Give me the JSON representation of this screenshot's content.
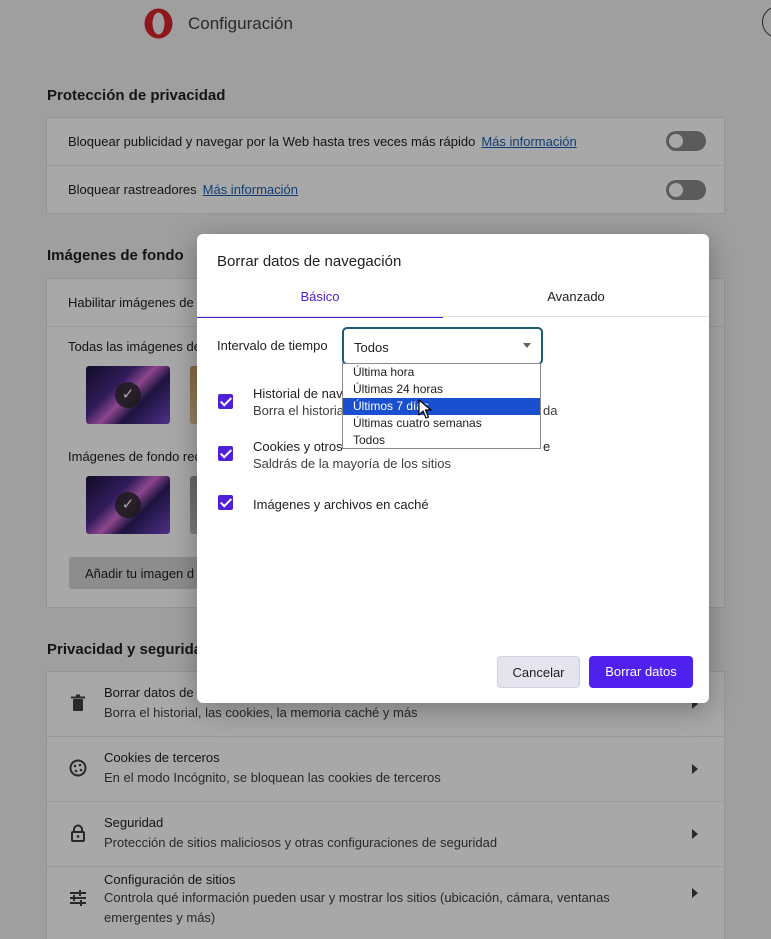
{
  "app": {
    "title": "Configuración"
  },
  "privacy_protection": {
    "title": "Protección de privacidad",
    "ads": {
      "label": "Bloquear publicidad y navegar por la Web hasta tres veces más rápido",
      "link": "Más información"
    },
    "trackers": {
      "label": "Bloquear rastreadores",
      "link": "Más información"
    }
  },
  "wallpapers": {
    "title": "Imágenes de fondo",
    "enable_label": "Habilitar imágenes de",
    "all_label": "Todas las imágenes de",
    "recent_label": "Imágenes de fondo rec",
    "add_button": "Añadir tu imagen d"
  },
  "privacy_security": {
    "title": "Privacidad y segurida",
    "items": [
      {
        "title": "Borrar datos de",
        "subtitle": "Borra el historial, las cookies, la memoria caché y más",
        "icon": "trash-icon"
      },
      {
        "title": "Cookies de terceros",
        "subtitle": "En el modo Incógnito, se bloquean las cookies de terceros",
        "icon": "cookie-icon"
      },
      {
        "title": "Seguridad",
        "subtitle": "Protección de sitios maliciosos y otras configuraciones de seguridad",
        "icon": "lock-icon"
      },
      {
        "title": "Configuración de sitios",
        "subtitle": "Controla qué información pueden usar y mostrar los sitios (ubicación, cámara, ventanas emergentes y más)",
        "icon": "sliders-icon"
      }
    ]
  },
  "dialog": {
    "title": "Borrar datos de navegación",
    "tabs": {
      "basic": "Básico",
      "advanced": "Avanzado"
    },
    "interval_label": "Intervalo de tiempo",
    "interval_value": "Todos",
    "options": {
      "history": {
        "title": "Historial de nav",
        "subtitle": "Borra el historial",
        "subtitle_tail": "da"
      },
      "cookies": {
        "title": "Cookies y otros",
        "title_tail": "e",
        "subtitle": "Saldrás de la mayoría de los sitios"
      },
      "cache": {
        "title": "Imágenes y archivos en caché"
      }
    },
    "cancel": "Cancelar",
    "clear": "Borrar datos"
  },
  "dropdown": {
    "options": [
      "Última hora",
      "Últimas 24 horas",
      "Últimos 7 días",
      "Últimas cuatro semanas",
      "Todos"
    ],
    "highlighted_index": 2
  },
  "colors": {
    "accent": "#5020ee",
    "link": "#1a5fb4",
    "highlight": "#1a4fd0"
  }
}
